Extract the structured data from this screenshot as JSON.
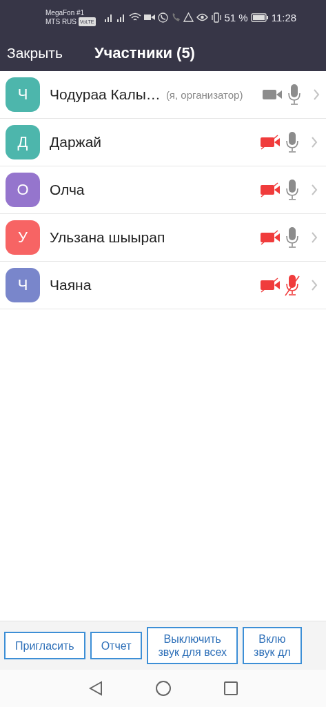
{
  "status_bar": {
    "carrier_1": "MegaFon #1",
    "carrier_2": "MTS RUS",
    "volte": "VoLTE",
    "battery": "51 %",
    "time": "11:28"
  },
  "header": {
    "close": "Закрыть",
    "title": "Участники (5)"
  },
  "participants": [
    {
      "initial": "Ч",
      "color": "#4db6ac",
      "name": "Чодураа Калы…",
      "note": "(я, организатор)",
      "video_muted": false,
      "mic_muted": false
    },
    {
      "initial": "Д",
      "color": "#4db6ac",
      "name": "Даржай",
      "video_muted": true,
      "mic_muted": false
    },
    {
      "initial": "О",
      "color": "#9575cd",
      "name": "Олча",
      "video_muted": true,
      "mic_muted": false
    },
    {
      "initial": "У",
      "color": "#f76464",
      "name": "Ульзана шыырап",
      "video_muted": true,
      "mic_muted": false
    },
    {
      "initial": "Ч",
      "color": "#7986cb",
      "name": "Чаяна",
      "video_muted": true,
      "mic_muted": true
    }
  ],
  "actions": [
    {
      "lines": [
        "Пригласить"
      ]
    },
    {
      "lines": [
        "Отчет"
      ]
    },
    {
      "lines": [
        "Выключить",
        "звук для всех"
      ]
    },
    {
      "lines": [
        "Вклю",
        "звук дл"
      ]
    }
  ]
}
